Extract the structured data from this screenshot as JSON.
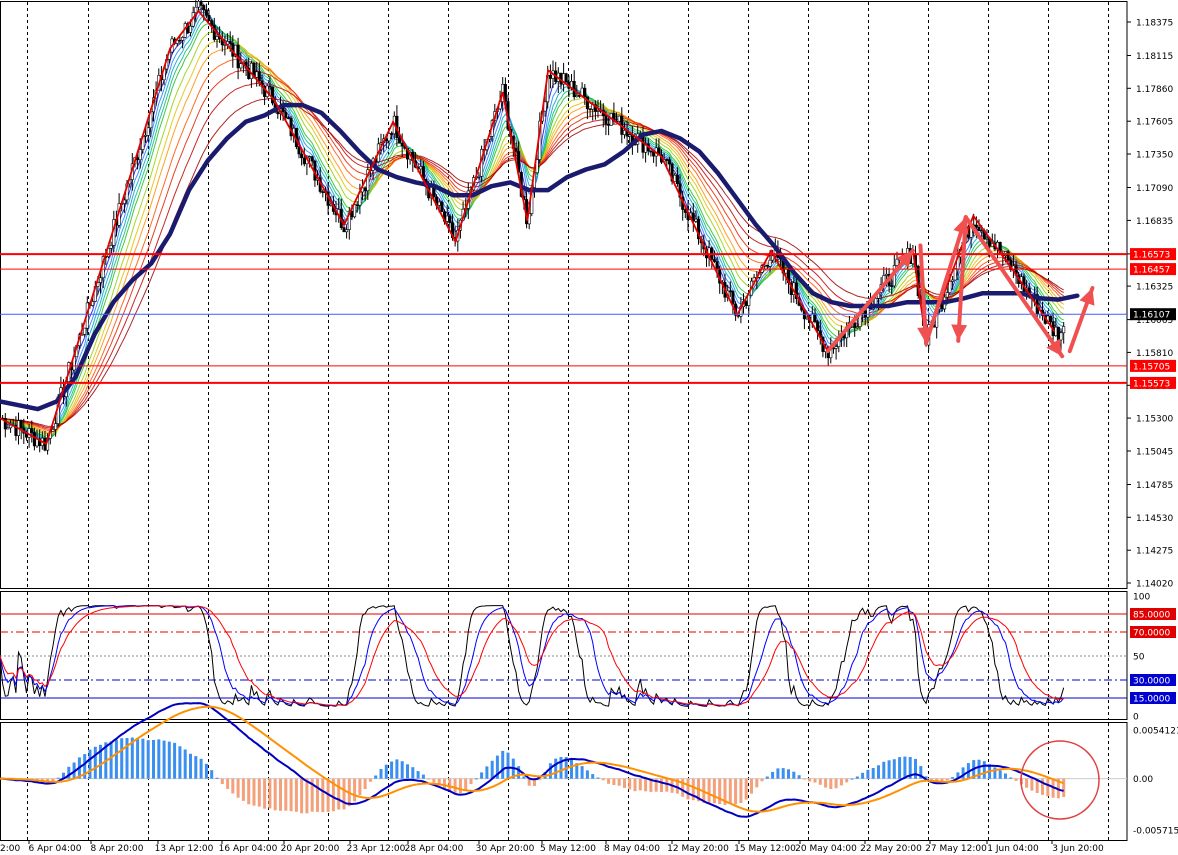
{
  "chart_data": [
    {
      "panel": "main",
      "type": "candlestick",
      "y_ticks": [
        "1.18375",
        "1.18115",
        "1.17860",
        "1.17605",
        "1.17350",
        "1.17090",
        "1.16835",
        "1.16575",
        "1.16325",
        "1.16065",
        "1.15810",
        "1.15555",
        "1.15300",
        "1.15045",
        "1.14785",
        "1.14530",
        "1.14275",
        "1.14020"
      ],
      "ylim": [
        1.1398,
        1.1847
      ],
      "current_price": {
        "label": "1.16107",
        "value": 1.16107
      },
      "levels": [
        {
          "label": "1.16573",
          "value": 1.16573
        },
        {
          "label": "1.16457",
          "value": 1.16457
        },
        {
          "label": "1.15705",
          "value": 1.15705
        },
        {
          "label": "1.15573",
          "value": 1.15573
        }
      ],
      "zigzag": [
        {
          "x": 0.0,
          "y": 1.153
        },
        {
          "x": 2.45,
          "y": 1.151
        },
        {
          "x": 9.0,
          "y": 1.1817
        },
        {
          "x": 10.5,
          "y": 1.1846
        },
        {
          "x": 14.5,
          "y": 1.1777
        },
        {
          "x": 18.2,
          "y": 1.168
        },
        {
          "x": 20.8,
          "y": 1.176
        },
        {
          "x": 24.1,
          "y": 1.1667
        },
        {
          "x": 26.6,
          "y": 1.1783
        },
        {
          "x": 27.9,
          "y": 1.1683
        },
        {
          "x": 29.0,
          "y": 1.18
        },
        {
          "x": 35.0,
          "y": 1.1733
        },
        {
          "x": 39.0,
          "y": 1.161
        },
        {
          "x": 40.8,
          "y": 1.166
        },
        {
          "x": 43.8,
          "y": 1.1582
        },
        {
          "x": 48.3,
          "y": 1.166
        },
        {
          "x": 49.0,
          "y": 1.159
        },
        {
          "x": 51.5,
          "y": 1.1687
        },
        {
          "x": 53.5,
          "y": 1.1647
        },
        {
          "x": 55.8,
          "y": 1.1597
        }
      ],
      "forecast_arrows": [
        {
          "from": {
            "x": 43.8,
            "y": 1.1582
          },
          "to": {
            "x": 48.3,
            "y": 1.166
          }
        },
        {
          "from": {
            "x": 48.7,
            "y": 1.1664
          },
          "to": {
            "x": 49.0,
            "y": 1.1588
          }
        },
        {
          "from": {
            "x": 49.0,
            "y": 1.1588
          },
          "to": {
            "x": 51.1,
            "y": 1.1686
          }
        },
        {
          "from": {
            "x": 51.1,
            "y": 1.1686
          },
          "to": {
            "x": 50.7,
            "y": 1.159
          }
        },
        {
          "from": {
            "x": 51.1,
            "y": 1.1686
          },
          "to": {
            "x": 56.2,
            "y": 1.1578
          }
        },
        {
          "from": {
            "x": 56.6,
            "y": 1.1582
          },
          "to": {
            "x": 57.8,
            "y": 1.1631
          }
        }
      ],
      "slow_ma": [
        {
          "x": 0,
          "y": 1.1543
        },
        {
          "x": 2,
          "y": 1.1537
        },
        {
          "x": 3,
          "y": 1.1543
        },
        {
          "x": 4,
          "y": 1.1562
        },
        {
          "x": 5,
          "y": 1.1595
        },
        {
          "x": 6,
          "y": 1.162
        },
        {
          "x": 7,
          "y": 1.1637
        },
        {
          "x": 8,
          "y": 1.165
        },
        {
          "x": 9,
          "y": 1.1673
        },
        {
          "x": 10,
          "y": 1.1707
        },
        {
          "x": 11,
          "y": 1.173
        },
        {
          "x": 12,
          "y": 1.1747
        },
        {
          "x": 13,
          "y": 1.176
        },
        {
          "x": 14,
          "y": 1.1765
        },
        {
          "x": 15,
          "y": 1.1773
        },
        {
          "x": 16,
          "y": 1.1773
        },
        {
          "x": 17,
          "y": 1.1767
        },
        {
          "x": 18,
          "y": 1.1753
        },
        {
          "x": 19,
          "y": 1.1737
        },
        {
          "x": 20,
          "y": 1.1723
        },
        {
          "x": 21,
          "y": 1.1717
        },
        {
          "x": 22,
          "y": 1.1713
        },
        {
          "x": 23,
          "y": 1.171
        },
        {
          "x": 24,
          "y": 1.1703
        },
        {
          "x": 25,
          "y": 1.1703
        },
        {
          "x": 26,
          "y": 1.171
        },
        {
          "x": 27,
          "y": 1.1713
        },
        {
          "x": 28,
          "y": 1.1707
        },
        {
          "x": 29,
          "y": 1.1707
        },
        {
          "x": 30,
          "y": 1.1717
        },
        {
          "x": 31,
          "y": 1.1723
        },
        {
          "x": 32,
          "y": 1.1727
        },
        {
          "x": 33,
          "y": 1.1737
        },
        {
          "x": 34,
          "y": 1.175
        },
        {
          "x": 35,
          "y": 1.1753
        },
        {
          "x": 36,
          "y": 1.1747
        },
        {
          "x": 37,
          "y": 1.1737
        },
        {
          "x": 38,
          "y": 1.172
        },
        {
          "x": 39,
          "y": 1.17
        },
        {
          "x": 40,
          "y": 1.168
        },
        {
          "x": 41,
          "y": 1.1663
        },
        {
          "x": 42,
          "y": 1.1643
        },
        {
          "x": 43,
          "y": 1.1627
        },
        {
          "x": 44,
          "y": 1.162
        },
        {
          "x": 45,
          "y": 1.1617
        },
        {
          "x": 46,
          "y": 1.1617
        },
        {
          "x": 47,
          "y": 1.1617
        },
        {
          "x": 48,
          "y": 1.162
        },
        {
          "x": 49,
          "y": 1.162
        },
        {
          "x": 50,
          "y": 1.162
        },
        {
          "x": 51,
          "y": 1.1623
        },
        {
          "x": 52,
          "y": 1.1627
        },
        {
          "x": 53,
          "y": 1.1627
        },
        {
          "x": 54,
          "y": 1.1627
        },
        {
          "x": 55,
          "y": 1.1623
        },
        {
          "x": 56,
          "y": 1.1622
        },
        {
          "x": 57,
          "y": 1.1625
        }
      ],
      "ribbon_colors": [
        "#1010e8",
        "#2080ff",
        "#00a0d0",
        "#00c080",
        "#20c020",
        "#90d000",
        "#e0c000",
        "#ff9000",
        "#ff5000",
        "#e02000",
        "#c00000",
        "#a00000"
      ]
    },
    {
      "panel": "oscillator",
      "type": "line",
      "y_ticks": [
        "100",
        "50",
        "0"
      ],
      "ylim": [
        0,
        100
      ],
      "levels": [
        {
          "label": "85.0000",
          "value": 85,
          "color": "#e00000"
        },
        {
          "label": "70.0000",
          "value": 70,
          "color": "#e00000"
        },
        {
          "label": "30.0000",
          "value": 30,
          "color": "#0000d0"
        },
        {
          "label": "15.0000",
          "value": 15,
          "color": "#0000d0"
        }
      ]
    },
    {
      "panel": "macd",
      "type": "histogram",
      "y_ticks": [
        "0.0054121",
        "0.00",
        "-0.0057152"
      ],
      "ylim": [
        -0.0057152,
        0.0054121
      ]
    }
  ],
  "x_ticks": [
    "6 Apr 04:00",
    "8 Apr 20:00",
    "13 Apr 12:00",
    "16 Apr 04:00",
    "20 Apr 20:00",
    "23 Apr 12:00",
    "28 Apr 04:00",
    "30 Apr 20:00",
    "5 May 12:00",
    "8 May 04:00",
    "12 May 20:00",
    "15 May 12:00",
    "20 May 04:00",
    "22 May 20:00",
    "27 May 12:00",
    "1 Jun 04:00",
    "3 Jun 20:00"
  ],
  "x_tick_first": "2:00",
  "colors": {
    "level_line": "#ff0000",
    "current_line": "#4060ff",
    "zigzag": "#e00000",
    "arrow": "#f05050",
    "slow_ma": "#1a1a6e",
    "hist_up": "#3a8ff0",
    "hist_down": "#f4a07a",
    "macd_line": "#0000c0",
    "signal_line": "#ff9000",
    "highlight_circle": "#e04040"
  }
}
